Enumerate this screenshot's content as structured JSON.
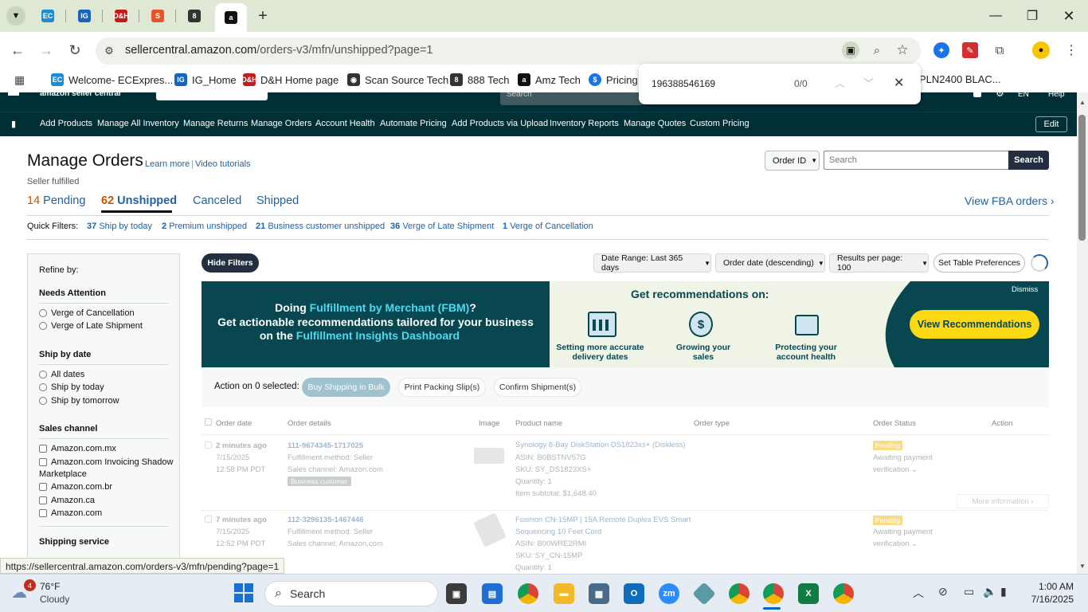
{
  "browser": {
    "tabs": [
      {
        "icon": "ec-icon",
        "abbr": "EC",
        "color": "#1a8fd6"
      },
      {
        "icon": "ig-icon",
        "abbr": "IG",
        "color": "#1565c0"
      },
      {
        "icon": "dh-icon",
        "abbr": "D&H",
        "color": "#c41a1a"
      },
      {
        "icon": "scansource-icon",
        "abbr": "S",
        "color": "#e8552a"
      },
      {
        "icon": "888-icon",
        "abbr": "8",
        "color": "#333333"
      },
      {
        "icon": "amazon-icon",
        "abbr": "a",
        "color": "#111111"
      }
    ],
    "new_tab": "+",
    "url_host": "sellercentral.amazon.com",
    "url_path": "/orders-v3/mfn/unshipped?page=1",
    "bookmarks": [
      {
        "label": "Welcome- ECExpres...",
        "abbr": "EC",
        "color": "#1a8fd6"
      },
      {
        "label": "IG_Home",
        "abbr": "IG",
        "color": "#1565c0"
      },
      {
        "label": "D&H Home page",
        "abbr": "D&H",
        "color": "#c41a1a"
      },
      {
        "label": "Scan Source Tech",
        "abbr": "◉",
        "color": "#333333"
      },
      {
        "label": "888 Tech",
        "abbr": "8",
        "color": "#333333"
      },
      {
        "label": "Amz Tech",
        "abbr": "a",
        "color": "#111111"
      },
      {
        "label": "Pricing",
        "abbr": "$",
        "color": "#1a73e8"
      },
      {
        "label": "PLN2400 BLAC...",
        "abbr": "",
        "color": "#ffffff"
      }
    ],
    "find": {
      "query": "196388546169",
      "count": "0/0"
    },
    "status_url": "https://sellercentral.amazon.com/orders-v3/mfn/pending?page=1"
  },
  "seller": {
    "top_search_placeholder": "Search",
    "top_lang": "EN",
    "top_help": "Help",
    "menu": [
      "Add Products",
      "Manage All Inventory",
      "Manage Returns",
      "Manage Orders",
      "Account Health",
      "Automate Pricing",
      "Add Products via Upload",
      "Inventory Reports",
      "Manage Quotes",
      "Custom Pricing"
    ],
    "edit_label": "Edit",
    "title": "Manage Orders",
    "learn_more": "Learn more",
    "video_tutorials": "Video tutorials",
    "subtitle": "Seller fulfilled",
    "status_tabs": [
      {
        "count": "14",
        "label": "Pending"
      },
      {
        "count": "62",
        "label": "Unshipped"
      },
      {
        "count": "",
        "label": "Canceled"
      },
      {
        "count": "",
        "label": "Shipped"
      }
    ],
    "view_fba": "View FBA orders ›",
    "search_type": "Order ID",
    "search_placeholder": "Search",
    "search_button": "Search",
    "quick_filters_label": "Quick Filters:",
    "quick_filters": [
      {
        "count": "37",
        "label": "Ship by today"
      },
      {
        "count": "2",
        "label": "Premium unshipped"
      },
      {
        "count": "21",
        "label": "Business customer unshipped"
      },
      {
        "count": "36",
        "label": "Verge of Late Shipment"
      },
      {
        "count": "1",
        "label": "Verge of Cancellation"
      }
    ],
    "refine_by": "Refine by:",
    "needs_attention": {
      "title": "Needs Attention",
      "options": [
        "Verge of Cancellation",
        "Verge of Late Shipment"
      ]
    },
    "ship_by_date": {
      "title": "Ship by date",
      "options": [
        "All dates",
        "Ship by today",
        "Ship by tomorrow"
      ]
    },
    "sales_channel": {
      "title": "Sales channel",
      "options": [
        "Amazon.com.mx",
        "Amazon.com Invoicing Shadow",
        "Amazon.com.br",
        "Amazon.ca",
        "Amazon.com"
      ],
      "option2_line2": "Marketplace"
    },
    "shipping_service": "Shipping service",
    "hide_filters": "Hide Filters",
    "date_range": "Date Range: Last 365 days",
    "sort": "Order date (descending)",
    "per_page": "Results per page: 100",
    "table_prefs": "Set Table Preferences",
    "banner": {
      "line1a": "Doing ",
      "line1b": "Fulfillment by Merchant (FBM)",
      "line1c": "?",
      "line2": "Get actionable recommendations tailored for your business",
      "line3a": "on the ",
      "line3b": "Fulfillment Insights Dashboard",
      "heading": "Get recommendations on:",
      "dismiss": "Dismiss",
      "items": [
        {
          "line1": "Setting more accurate",
          "line2": "delivery dates"
        },
        {
          "line1": "Growing your",
          "line2": "sales"
        },
        {
          "line1": "Protecting your",
          "line2": "account health"
        }
      ],
      "button": "View Recommendations"
    },
    "action_label": "Action on 0 selected:",
    "buy_shipping": "Buy Shipping in Bulk",
    "print_slips": "Print Packing Slip(s)",
    "confirm_shipment": "Confirm Shipment(s)",
    "columns": [
      "Order date",
      "Order details",
      "Image",
      "Product name",
      "Order type",
      "Order Status",
      "Action"
    ],
    "orders": [
      {
        "age": "2 minutes ago",
        "date": "7/15/2025",
        "time": "12:58 PM PDT",
        "order_id": "111-9674345-1717025",
        "method": "Fulfillment method: Seller",
        "channel": "Sales channel: Amazon.com",
        "badge": "Business customer",
        "product": "Synology 8-Bay DiskStation DS1823xs+ (Diskless)",
        "asin": "ASIN: B0BSTNV57G",
        "sku": "SKU: SY_DS1823XS+",
        "qty": "Quantity: 1",
        "subtotal": "Item subtotal: $1,648.40",
        "status_badge": "Pending",
        "status1": "Awaiting payment",
        "status2": "verification",
        "more": "More information ›"
      },
      {
        "age": "7 minutes ago",
        "date": "7/15/2025",
        "time": "12:52 PM PDT",
        "order_id": "112-3296135-1467446",
        "method": "Fulfillment method: Seller",
        "channel": "Sales channel: Amazon.com",
        "product": "Fosmon CN-15MP | 15A Remote Duplex EVS Smart",
        "product2": "Sequencing 10 Feet Cord",
        "asin": "ASIN: B00WRE2RMI",
        "sku": "SKU: SY_CN-15MP",
        "qty": "Quantity: 1",
        "status_badge": "Pending",
        "status1": "Awaiting payment",
        "status2": "verification"
      }
    ]
  },
  "taskbar": {
    "weather_temp": "76°F",
    "weather_desc": "Cloudy",
    "weather_badge": "4",
    "search_label": "Search",
    "time": "1:00 AM",
    "date": "7/16/2025"
  }
}
